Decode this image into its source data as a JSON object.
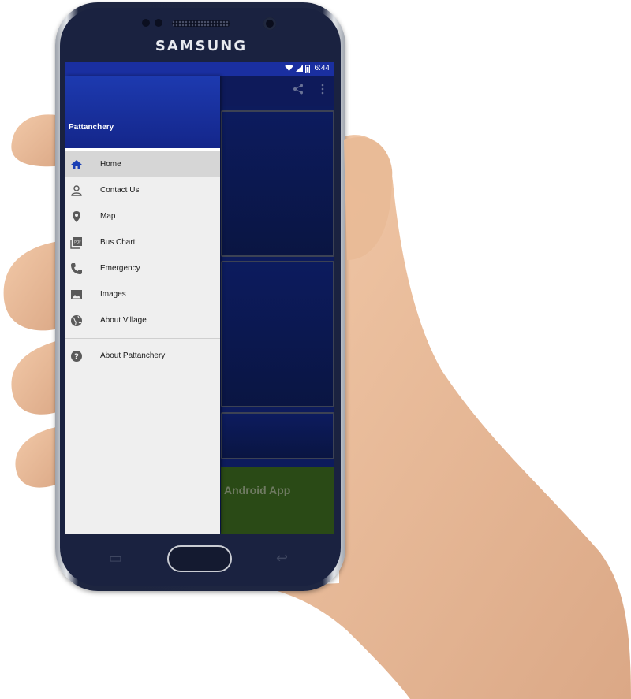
{
  "device": {
    "brand": "SAMSUNG"
  },
  "status_bar": {
    "time": "6:44"
  },
  "drawer": {
    "title": "Pattanchery",
    "items": [
      {
        "label": "Home",
        "icon": "home-icon",
        "active": true
      },
      {
        "label": "Contact Us",
        "icon": "person-icon"
      },
      {
        "label": "Map",
        "icon": "location-pin-icon"
      },
      {
        "label": "Bus Chart",
        "icon": "pdf-icon"
      },
      {
        "label": "Emergency",
        "icon": "phone-icon"
      },
      {
        "label": "Images",
        "icon": "image-icon"
      },
      {
        "label": "About Village",
        "icon": "globe-icon"
      }
    ],
    "secondary_items": [
      {
        "label": "About Pattanchery",
        "icon": "help-icon"
      }
    ]
  },
  "background_content": {
    "promo_text": "Android App"
  },
  "colors": {
    "drawer_header": "#1d3ab0",
    "status_bar": "#1a2fa0",
    "drawer_bg": "#efefef",
    "active_item": "#d6d6d6",
    "home_icon": "#1a3fb5",
    "promo_bg": "#2a4a16"
  }
}
